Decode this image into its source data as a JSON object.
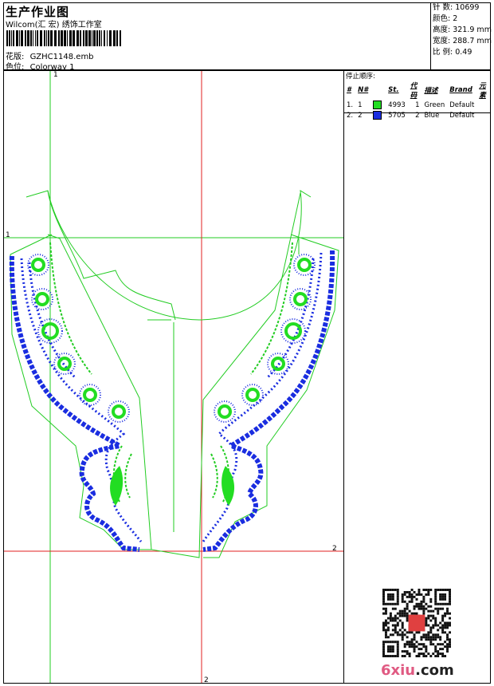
{
  "header": {
    "title": "生产作业图",
    "studio": "Wilcom(汇 宏) 绣饰工作室",
    "design_label": "花版:",
    "design_file": "GZHC1148.emb",
    "colorway_label": "色位:",
    "colorway": "Colorway 1"
  },
  "stats": {
    "stitches": "针 数: 10699",
    "colors": "颜色: 2",
    "height": "高度: 321.9 mm",
    "width": "宽度: 288.7 mm",
    "scale": "比 例: 0.49"
  },
  "legend": {
    "caption": "停止顺序:",
    "columns": [
      "#",
      "N#",
      "St.",
      "代码",
      "描述",
      "Brand",
      "元素"
    ],
    "rows": [
      {
        "idx": "1.",
        "n": "1",
        "color": "#22dd22",
        "st": "4993",
        "code": "1",
        "desc": "Green",
        "brand": "Default",
        "elem": ""
      },
      {
        "idx": "2.",
        "n": "2",
        "color": "#1a2de0",
        "st": "5705",
        "code": "2",
        "desc": "Blue",
        "brand": "Default",
        "elem": ""
      }
    ]
  },
  "guides": {
    "v1": "1",
    "h1": "1",
    "h2": "2",
    "v2": "2"
  },
  "watermark": {
    "text_main": "6xiu",
    "text_dot": ".com",
    "seal": "汇宏"
  }
}
